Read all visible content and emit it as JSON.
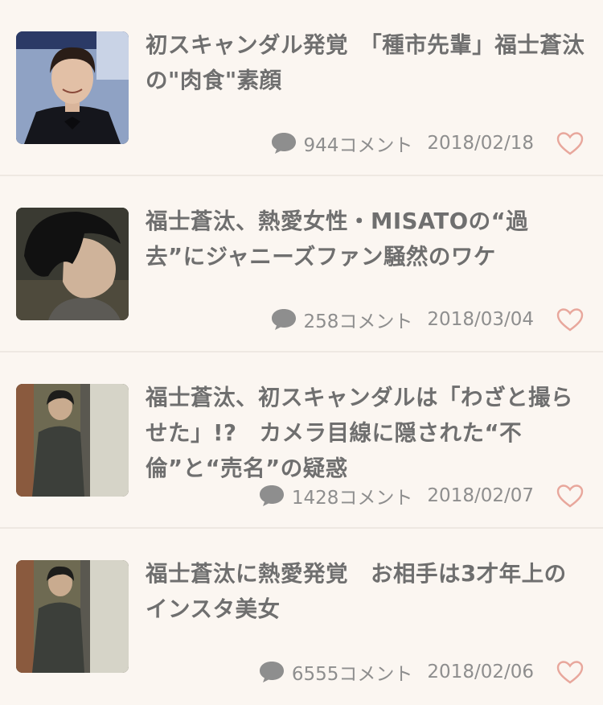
{
  "articles": [
    {
      "title": "初スキャンダル発覚　「種市先輩」福士蒼汰の\"肉食\"素顔",
      "comments": "944コメント",
      "date": "2018/02/18"
    },
    {
      "title": "福士蒼汰、熱愛女性・MISATOの“過去”にジャニーズファン騒然のワケ",
      "comments": "258コメント",
      "date": "2018/03/04"
    },
    {
      "title": "福士蒼汰、初スキャンダルは「わざと撮らせた」!?　カメラ目線に隠された“不倫”と“売名”の疑惑",
      "comments": "1428コメント",
      "date": "2018/02/07"
    },
    {
      "title": "福士蒼汰に熱愛発覚　お相手は3才年上のインスタ美女",
      "comments": "6555コメント",
      "date": "2018/02/06"
    }
  ],
  "icons": {
    "comment": "speech-bubble-icon",
    "favorite": "heart-icon"
  },
  "colors": {
    "background": "#fbf6f1",
    "title": "#6f6f6f",
    "meta": "#8e8e8e",
    "heart": "#e8a79c",
    "divider": "#eee8e2"
  }
}
